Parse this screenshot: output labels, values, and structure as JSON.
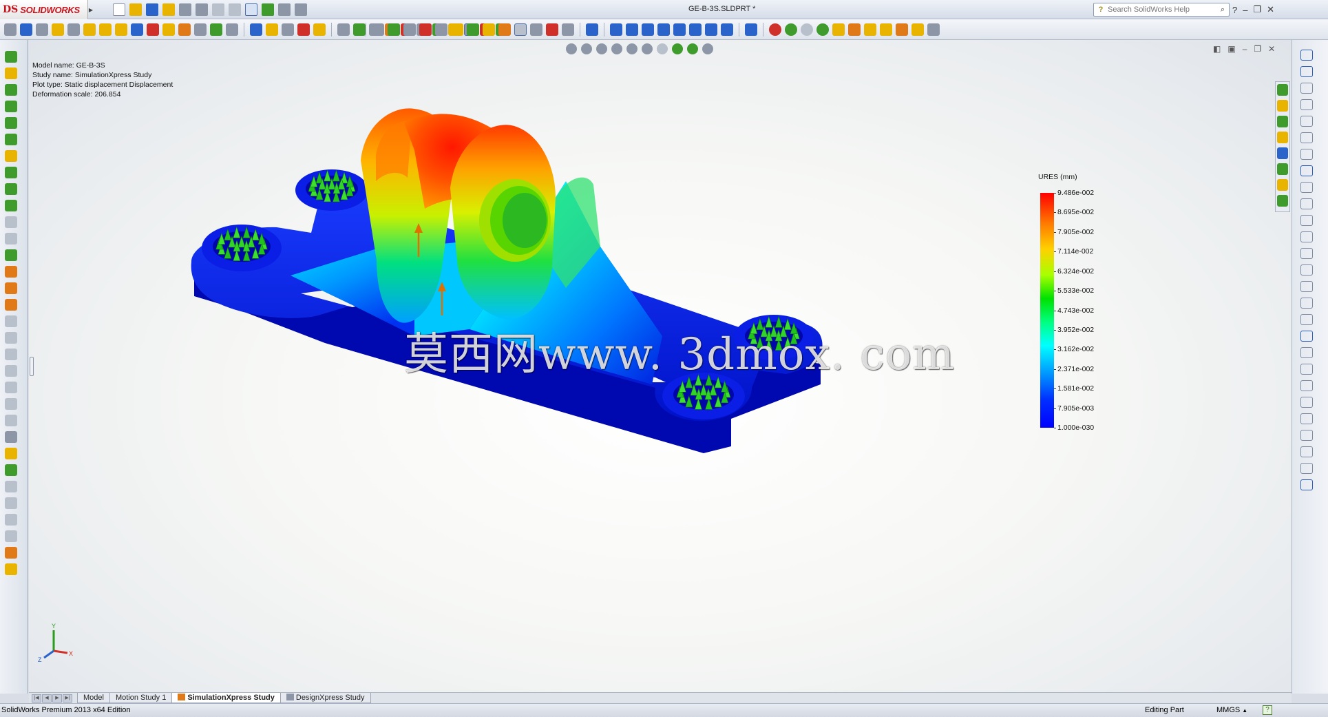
{
  "app": {
    "brand": "SOLIDWORKS",
    "brand_mark": "DS",
    "document_title": "GE-B-3S.SLDPRT *",
    "search_placeholder": "Search SolidWorks Help"
  },
  "study_info": {
    "model_name": "Model name: GE-B-3S",
    "study_name": "Study name: SimulationXpress Study",
    "plot_type": "Plot type: Static displacement Displacement",
    "deformation_scale": "Deformation scale: 206.854"
  },
  "legend": {
    "title": "URES (mm)",
    "values": [
      "9.486e-002",
      "8.695e-002",
      "7.905e-002",
      "7.114e-002",
      "6.324e-002",
      "5.533e-002",
      "4.743e-002",
      "3.952e-002",
      "3.162e-002",
      "2.371e-002",
      "1.581e-002",
      "7.905e-003",
      "1.000e-030"
    ],
    "colors": {
      "max": "#ff0000",
      "mid": "#00e100",
      "min": "#0000ff"
    }
  },
  "triad": {
    "x": "X",
    "y": "Y",
    "z": "Z"
  },
  "watermark": "莫西网www. 3dmox. com",
  "tabs": [
    {
      "label": "Model",
      "active": false,
      "icon": ""
    },
    {
      "label": "Motion Study 1",
      "active": false,
      "icon": ""
    },
    {
      "label": "SimulationXpress Study",
      "active": true,
      "icon": "simulation-icon"
    },
    {
      "label": "DesignXpress Study",
      "active": false,
      "icon": "design-study-icon"
    }
  ],
  "status": {
    "edition": "SolidWorks Premium 2013 x64 Edition",
    "mode": "Editing Part",
    "units": "MMGS",
    "units_arrow": "▲",
    "help": "?"
  },
  "window": {
    "help_glyph": "?",
    "minimize": "‒",
    "restore": "❐",
    "close": "✕"
  },
  "icon_colors": {
    "yellow": "#e8b400",
    "green": "#3e9b2c",
    "blue": "#2a63c9",
    "red": "#d0302a",
    "gray": "#8c96a6",
    "orange": "#e07a18"
  }
}
